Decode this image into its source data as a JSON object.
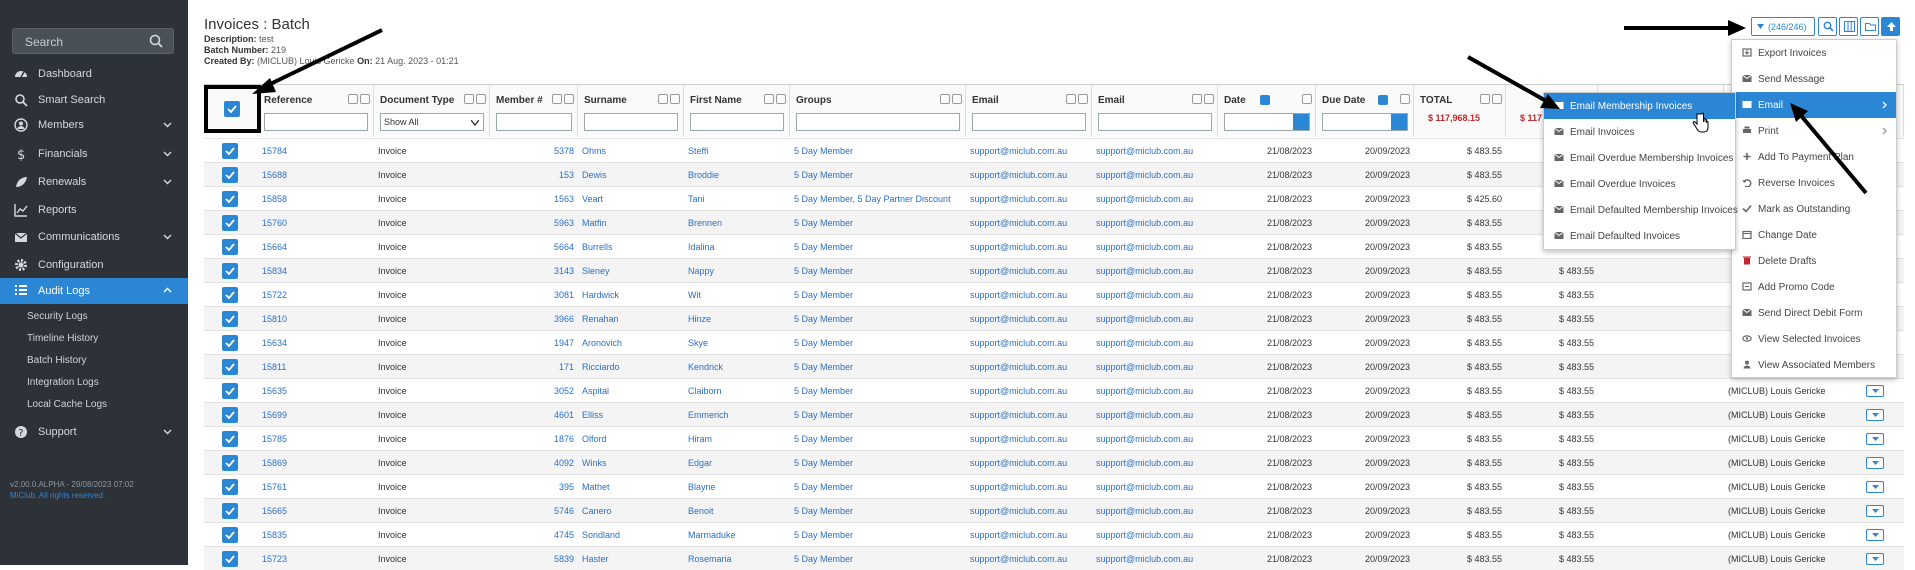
{
  "sidebar": {
    "search_placeholder": "Search",
    "items": [
      {
        "label": "Dashboard",
        "icon": "dashboard-icon"
      },
      {
        "label": "Smart Search",
        "icon": "smart-search-icon"
      },
      {
        "label": "Members",
        "icon": "members-icon"
      },
      {
        "label": "Financials",
        "icon": "dollar-icon"
      },
      {
        "label": "Renewals",
        "icon": "renewals-icon"
      },
      {
        "label": "Reports",
        "icon": "reports-icon"
      },
      {
        "label": "Communications",
        "icon": "envelope-icon"
      },
      {
        "label": "Configuration",
        "icon": "gear-icon"
      },
      {
        "label": "Audit Logs",
        "icon": "list-icon"
      },
      {
        "label": "Support",
        "icon": "help-icon"
      }
    ],
    "audit_sub": [
      "Security Logs",
      "Timeline History",
      "Batch History",
      "Integration Logs",
      "Local Cache Logs"
    ],
    "version": "v2.00.0.ALPHA - 29/08/2023 07:02",
    "copyright": "MiClub. All rights reserved."
  },
  "page": {
    "title": "Invoices : Batch",
    "description_label": "Description:",
    "description": "test",
    "batch_label": "Batch Number:",
    "batch": "219",
    "created_label": "Created By:",
    "created_by": "(MICLUB) Louis Gericke",
    "created_on_label": "On:",
    "created_on": "21 Aug. 2023 - 01:21"
  },
  "toolbar": {
    "count": "(246/246)"
  },
  "columns": {
    "reference": "Reference",
    "doctype": "Document Type",
    "member": "Member #",
    "surname": "Surname",
    "firstname": "First Name",
    "groups": "Groups",
    "email1": "Email",
    "email2": "Email",
    "date": "Date",
    "due": "Due Date",
    "total": "TOTAL",
    "total_sum": "$ 117,968.15",
    "total2_sum": "$ 117",
    "doctype_filter": "Show All"
  },
  "rows": [
    {
      "ref": "15784",
      "type": "Invoice",
      "member": "5378",
      "surname": "Ohms",
      "first": "Steffi",
      "groups": "5 Day Member",
      "email": "support@miclub.com.au",
      "date": "21/08/2023",
      "due": "20/09/2023",
      "total": "$ 483.55",
      "total2": "",
      "owner": ""
    },
    {
      "ref": "15688",
      "type": "Invoice",
      "member": "153",
      "surname": "Dewis",
      "first": "Broddie",
      "groups": "5 Day Member",
      "email": "support@miclub.com.au",
      "date": "21/08/2023",
      "due": "20/09/2023",
      "total": "$ 483.55",
      "total2": "",
      "owner": ""
    },
    {
      "ref": "15858",
      "type": "Invoice",
      "member": "1563",
      "surname": "Veart",
      "first": "Tani",
      "groups": "5 Day Member, 5 Day Partner Discount",
      "email": "support@miclub.com.au",
      "date": "21/08/2023",
      "due": "20/09/2023",
      "total": "$ 425.60",
      "total2": "",
      "owner": ""
    },
    {
      "ref": "15760",
      "type": "Invoice",
      "member": "5963",
      "surname": "Matfin",
      "first": "Brennen",
      "groups": "5 Day Member",
      "email": "support@miclub.com.au",
      "date": "21/08/2023",
      "due": "20/09/2023",
      "total": "$ 483.55",
      "total2": "",
      "owner": ""
    },
    {
      "ref": "15664",
      "type": "Invoice",
      "member": "5664",
      "surname": "Burrells",
      "first": "Idalina",
      "groups": "5 Day Member",
      "email": "support@miclub.com.au",
      "date": "21/08/2023",
      "due": "20/09/2023",
      "total": "$ 483.55",
      "total2": "",
      "owner": ""
    },
    {
      "ref": "15834",
      "type": "Invoice",
      "member": "3143",
      "surname": "Sleney",
      "first": "Nappy",
      "groups": "5 Day Member",
      "email": "support@miclub.com.au",
      "date": "21/08/2023",
      "due": "20/09/2023",
      "total": "$ 483.55",
      "total2": "$ 483.55",
      "owner": ""
    },
    {
      "ref": "15722",
      "type": "Invoice",
      "member": "3081",
      "surname": "Hardwick",
      "first": "Wit",
      "groups": "5 Day Member",
      "email": "support@miclub.com.au",
      "date": "21/08/2023",
      "due": "20/09/2023",
      "total": "$ 483.55",
      "total2": "$ 483.55",
      "owner": ""
    },
    {
      "ref": "15810",
      "type": "Invoice",
      "member": "3966",
      "surname": "Renahan",
      "first": "Hinze",
      "groups": "5 Day Member",
      "email": "support@miclub.com.au",
      "date": "21/08/2023",
      "due": "20/09/2023",
      "total": "$ 483.55",
      "total2": "$ 483.55",
      "owner": ""
    },
    {
      "ref": "15634",
      "type": "Invoice",
      "member": "1947",
      "surname": "Aronovich",
      "first": "Skye",
      "groups": "5 Day Member",
      "email": "support@miclub.com.au",
      "date": "21/08/2023",
      "due": "20/09/2023",
      "total": "$ 483.55",
      "total2": "$ 483.55",
      "owner": ""
    },
    {
      "ref": "15811",
      "type": "Invoice",
      "member": "171",
      "surname": "Ricciardo",
      "first": "Kendrick",
      "groups": "5 Day Member",
      "email": "support@miclub.com.au",
      "date": "21/08/2023",
      "due": "20/09/2023",
      "total": "$ 483.55",
      "total2": "$ 483.55",
      "owner": ""
    },
    {
      "ref": "15635",
      "type": "Invoice",
      "member": "3052",
      "surname": "Aspital",
      "first": "Claiborn",
      "groups": "5 Day Member",
      "email": "support@miclub.com.au",
      "date": "21/08/2023",
      "due": "20/09/2023",
      "total": "$ 483.55",
      "total2": "$ 483.55",
      "owner": "(MICLUB) Louis Gericke"
    },
    {
      "ref": "15699",
      "type": "Invoice",
      "member": "4601",
      "surname": "Elliss",
      "first": "Emmerich",
      "groups": "5 Day Member",
      "email": "support@miclub.com.au",
      "date": "21/08/2023",
      "due": "20/09/2023",
      "total": "$ 483.55",
      "total2": "$ 483.55",
      "owner": "(MICLUB) Louis Gericke"
    },
    {
      "ref": "15785",
      "type": "Invoice",
      "member": "1876",
      "surname": "Olford",
      "first": "Hiram",
      "groups": "5 Day Member",
      "email": "support@miclub.com.au",
      "date": "21/08/2023",
      "due": "20/09/2023",
      "total": "$ 483.55",
      "total2": "$ 483.55",
      "owner": "(MICLUB) Louis Gericke"
    },
    {
      "ref": "15869",
      "type": "Invoice",
      "member": "4092",
      "surname": "Winks",
      "first": "Edgar",
      "groups": "5 Day Member",
      "email": "support@miclub.com.au",
      "date": "21/08/2023",
      "due": "20/09/2023",
      "total": "$ 483.55",
      "total2": "$ 483.55",
      "owner": "(MICLUB) Louis Gericke"
    },
    {
      "ref": "15761",
      "type": "Invoice",
      "member": "395",
      "surname": "Mathet",
      "first": "Blayne",
      "groups": "5 Day Member",
      "email": "support@miclub.com.au",
      "date": "21/08/2023",
      "due": "20/09/2023",
      "total": "$ 483.55",
      "total2": "$ 483.55",
      "owner": "(MICLUB) Louis Gericke"
    },
    {
      "ref": "15665",
      "type": "Invoice",
      "member": "5746",
      "surname": "Canero",
      "first": "Benoit",
      "groups": "5 Day Member",
      "email": "support@miclub.com.au",
      "date": "21/08/2023",
      "due": "20/09/2023",
      "total": "$ 483.55",
      "total2": "$ 483.55",
      "owner": "(MICLUB) Louis Gericke"
    },
    {
      "ref": "15835",
      "type": "Invoice",
      "member": "4745",
      "surname": "Sondland",
      "first": "Marmaduke",
      "groups": "5 Day Member",
      "email": "support@miclub.com.au",
      "date": "21/08/2023",
      "due": "20/09/2023",
      "total": "$ 483.55",
      "total2": "$ 483.55",
      "owner": "(MICLUB) Louis Gericke"
    },
    {
      "ref": "15723",
      "type": "Invoice",
      "member": "5839",
      "surname": "Haster",
      "first": "Rosemaria",
      "groups": "5 Day Member",
      "email": "support@miclub.com.au",
      "date": "21/08/2023",
      "due": "20/09/2023",
      "total": "$ 483.55",
      "total2": "$ 483.55",
      "owner": "(MICLUB) Louis Gericke"
    }
  ],
  "menu": {
    "items": [
      "Export Invoices",
      "Send Message",
      "Email",
      "Print",
      "Add To Payment Plan",
      "Reverse Invoices",
      "Mark as Outstanding",
      "Change Date",
      "Delete Drafts",
      "Add Promo Code",
      "Send Direct Debit Form",
      "View Selected Invoices",
      "View Associated Members"
    ],
    "email_sub": [
      "Email Membership Invoices",
      "Email Invoices",
      "Email Overdue Membership Invoices",
      "Email Overdue Invoices",
      "Email Defaulted Membership Invoices",
      "Email Defaulted Invoices"
    ]
  },
  "colors": {
    "accent": "#2b86d6",
    "sidebar": "#2d3239",
    "total_red": "#c0282d"
  }
}
